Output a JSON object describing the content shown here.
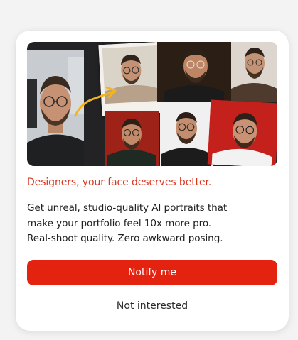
{
  "promo": {
    "image_alt": "AI-generated studio portraits of a man with glasses",
    "headline": "Designers, your face deserves better.",
    "body_lines": [
      "Get unreal, studio-quality AI portraits that",
      "make your portfolio feel 10x more pro.",
      "Real-shoot quality. Zero awkward posing."
    ],
    "notify_label": "Notify me",
    "dismiss_label": "Not interested"
  },
  "colors": {
    "accent": "#e3230f",
    "headline": "#d8361f",
    "card_bg": "#ffffff",
    "page_bg": "#f3f3f3"
  }
}
